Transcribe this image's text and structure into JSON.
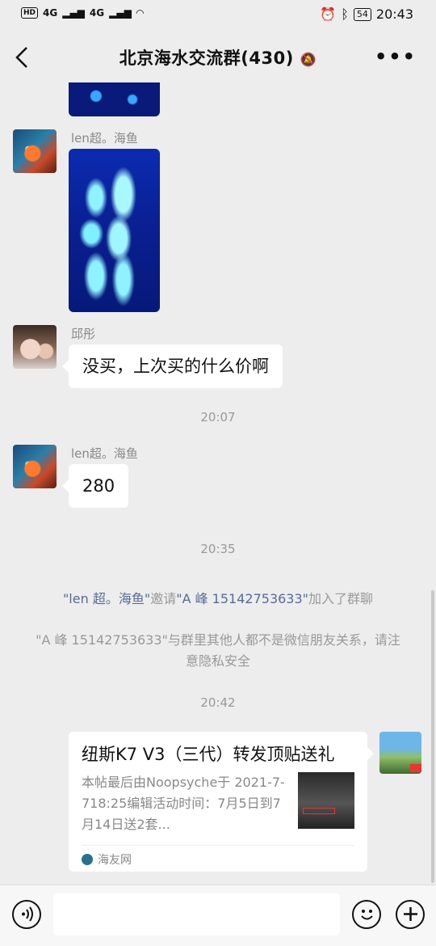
{
  "status_bar": {
    "left": [
      "HD",
      "4G",
      "4G"
    ],
    "battery": "54",
    "time": "20:43"
  },
  "nav": {
    "title": "北京海水交流群(430)"
  },
  "messages": {
    "m1": {
      "sender": "len超。海鱼"
    },
    "m2": {
      "sender": "邱彤",
      "text": "没买，上次买的什么价啊"
    },
    "t1": "20:07",
    "m3": {
      "sender": "len超。海鱼",
      "text": "280"
    },
    "t2": "20:35",
    "sys1": {
      "q1": "\"len 超。海鱼\"",
      "mid": "邀请",
      "q2": "\"A 峰 15142753633\"",
      "end": "加入了群聊"
    },
    "sys2": "\"A 峰 15142753633\"与群里其他人都不是微信朋友关系，请注意隐私安全",
    "t3": "20:42",
    "card": {
      "title": "纽斯K7 V3（三代）转发顶贴送礼",
      "desc": "本帖最后由Noopsyche于 2021-7-718:25编辑活动时间：7月5日到7月14日送2套...",
      "source": "海友网"
    }
  },
  "colors": {
    "background": "#ededed",
    "link": "#576b95",
    "muted": "#999999"
  }
}
